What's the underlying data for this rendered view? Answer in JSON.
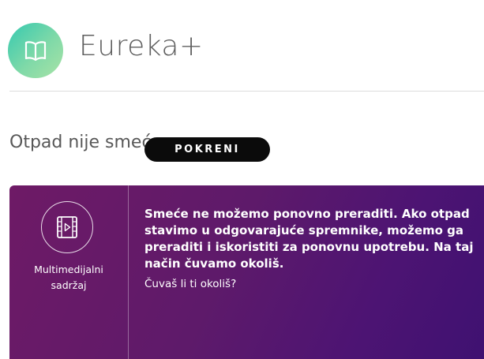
{
  "header": {
    "logo_icon": "book-icon",
    "app_title": "Eureka+"
  },
  "section": {
    "title": "Otpad nije smeće"
  },
  "card": {
    "icon": "film-play-icon",
    "type_label_line1": "Multimedijalni",
    "type_label_line2": "sadržaj",
    "text": "Smeće ne možemo ponovno preraditi. Ako otpad stavimo u odgovarajuće spremnike, možemo ga preraditi i iskoristiti za ponovnu upotrebu. Na taj način čuvamo okoliš.",
    "question": "Čuvaš li ti okoliš?",
    "button_label": "POKRENI"
  },
  "colors": {
    "logo_gradient_start": "#35c9b0",
    "logo_gradient_end": "#a9e3a6",
    "card_gradient_start": "#6e1a66",
    "card_gradient_end": "#3f1171",
    "button_bg": "#0b0b0b"
  }
}
